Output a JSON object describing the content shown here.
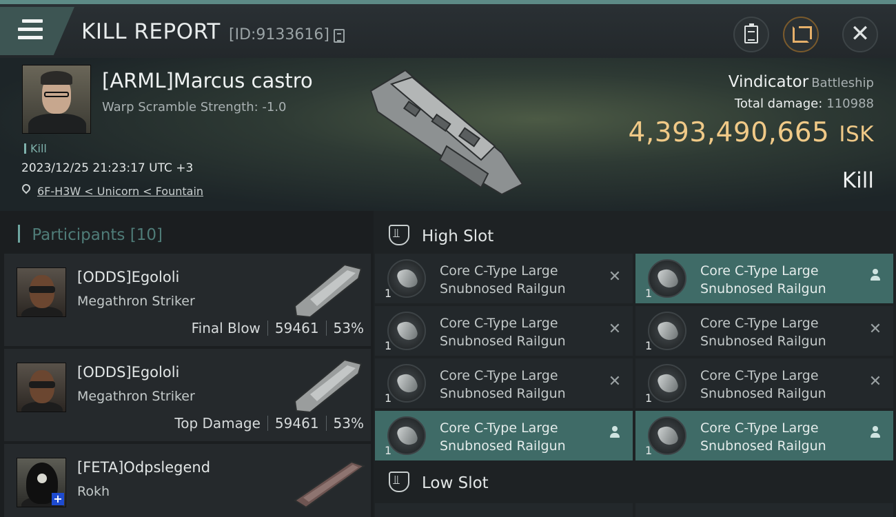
{
  "header": {
    "title": "KILL REPORT",
    "report_id": "[ID:9133616]"
  },
  "victim": {
    "name": "[ARML]Marcus castro",
    "warp_scramble": "Warp Scramble Strength: -1.0",
    "tag": "Kill",
    "time": "2023/12/25 21:23:17 UTC +3",
    "location": "6F-H3W < Unicorn < Fountain",
    "ship": "Vindicator",
    "ship_class": "Battleship",
    "total_damage_label": "Total damage:",
    "total_damage": "110988",
    "isk_value": "4,393,490,665",
    "isk_unit": "ISK",
    "result": "Kill"
  },
  "participants": {
    "title": "Participants",
    "count": "[10]",
    "rows": [
      {
        "name": "[ODDS]Egololi",
        "ship": "Megathron Striker",
        "role": "Final Blow",
        "damage": "59461",
        "percent": "53%"
      },
      {
        "name": "[ODDS]Egololi",
        "ship": "Megathron Striker",
        "role": "Top Damage",
        "damage": "59461",
        "percent": "53%"
      },
      {
        "name": "[FETA]Odpslegend",
        "ship": "Rokh",
        "role": "",
        "damage": "",
        "percent": ""
      }
    ]
  },
  "slots": {
    "high_slot_title": "High Slot",
    "low_slot_title": "Low Slot",
    "high_modules": [
      {
        "line1": "Core C-Type Large",
        "line2": "Snubnosed Railgun",
        "qty": "1",
        "state": "destroyed"
      },
      {
        "line1": "Core C-Type Large",
        "line2": "Snubnosed Railgun",
        "qty": "1",
        "state": "dropped"
      },
      {
        "line1": "Core C-Type Large",
        "line2": "Snubnosed Railgun",
        "qty": "1",
        "state": "destroyed"
      },
      {
        "line1": "Core C-Type Large",
        "line2": "Snubnosed Railgun",
        "qty": "1",
        "state": "destroyed"
      },
      {
        "line1": "Core C-Type Large",
        "line2": "Snubnosed Railgun",
        "qty": "1",
        "state": "destroyed"
      },
      {
        "line1": "Core C-Type Large",
        "line2": "Snubnosed Railgun",
        "qty": "1",
        "state": "destroyed"
      },
      {
        "line1": "Core C-Type Large",
        "line2": "Snubnosed Railgun",
        "qty": "1",
        "state": "dropped"
      },
      {
        "line1": "Core C-Type Large",
        "line2": "Snubnosed Railgun",
        "qty": "1",
        "state": "dropped"
      }
    ]
  },
  "colors": {
    "accent": "#5d8a86",
    "isk_gold": "#f0c987",
    "fitted_bg": "#3f6b67"
  },
  "icons": {
    "menu": "menu-icon",
    "copy": "copy-icon",
    "clipboard": "clipboard-icon",
    "share": "share-icon",
    "close": "close-icon",
    "location": "location-pin-icon",
    "slot": "high-slot-icon",
    "destroyed": "x-mark-icon",
    "dropped": "person-icon"
  }
}
